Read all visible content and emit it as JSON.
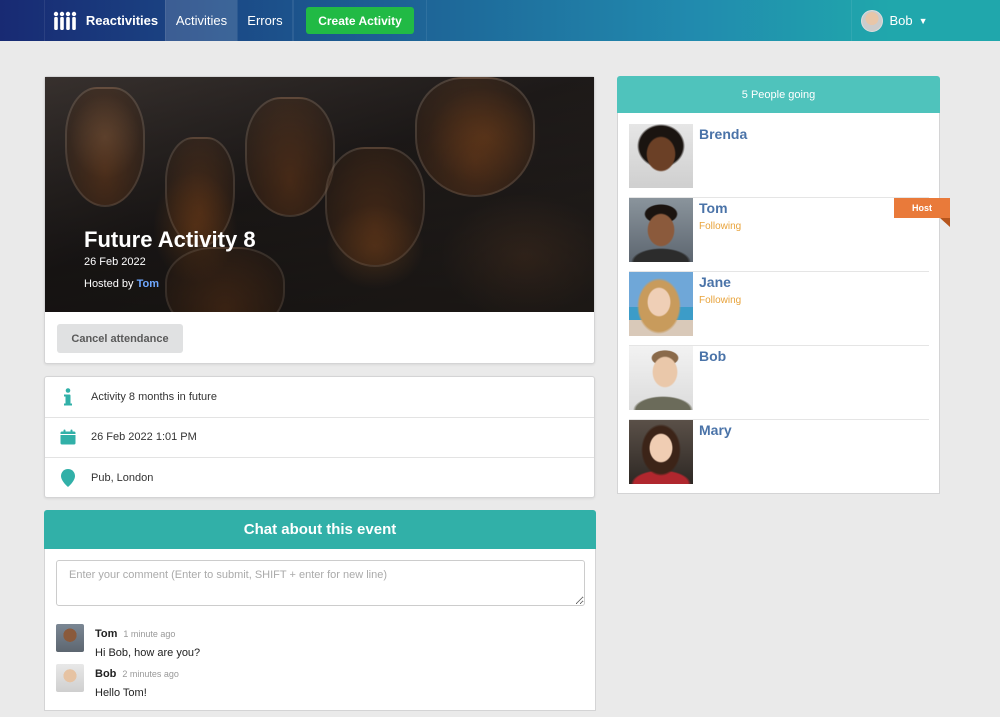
{
  "navbar": {
    "brand": "Reactivities",
    "activities": "Activities",
    "errors": "Errors",
    "create_activity": "Create Activity",
    "user_name": "Bob"
  },
  "activity": {
    "title": "Future Activity 8",
    "date": "26 Feb 2022",
    "hosted_by_prefix": "Hosted by ",
    "host_name": "Tom",
    "cancel_button": "Cancel attendance"
  },
  "details": {
    "description": "Activity 8 months in future",
    "datetime": "26 Feb 2022 1:01 PM",
    "venue": "Pub, London"
  },
  "chat": {
    "title": "Chat about this event",
    "placeholder": "Enter your comment (Enter to submit, SHIFT + enter for new line)",
    "comments": [
      {
        "author": "Tom",
        "time": "1 minute ago",
        "text": "Hi Bob, how are you?"
      },
      {
        "author": "Bob",
        "time": "2 minutes ago",
        "text": "Hello Tom!"
      }
    ]
  },
  "attendees": {
    "header": "5 People going",
    "host_label": "Host",
    "people": [
      {
        "name": "Brenda",
        "status": ""
      },
      {
        "name": "Tom",
        "status": "Following"
      },
      {
        "name": "Jane",
        "status": "Following"
      },
      {
        "name": "Bob",
        "status": ""
      },
      {
        "name": "Mary",
        "status": ""
      }
    ]
  },
  "colors": {
    "teal": "#31b0a8",
    "green_button": "#21ba45",
    "host_ribbon": "#e97a3a",
    "link_blue": "#4a73a8",
    "following": "#e8a33b"
  }
}
